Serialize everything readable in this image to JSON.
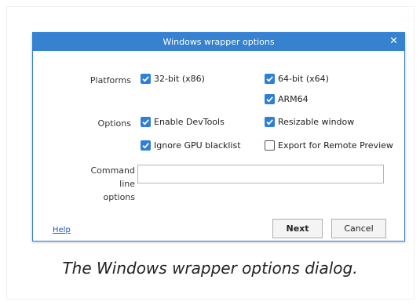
{
  "dialog": {
    "title": "Windows wrapper options",
    "close_glyph": "✕",
    "accent_color": "#2f7ed8"
  },
  "platforms": {
    "label": "Platforms",
    "options": [
      {
        "label": "32-bit (x86)",
        "checked": true
      },
      {
        "label": "64-bit (x64)",
        "checked": true
      },
      {
        "label": "ARM64",
        "checked": true
      }
    ]
  },
  "options": {
    "label": "Options",
    "items": [
      {
        "label": "Enable DevTools",
        "checked": true
      },
      {
        "label": "Resizable window",
        "checked": true
      },
      {
        "label": "Ignore GPU blacklist",
        "checked": true
      },
      {
        "label": "Export for Remote Preview",
        "checked": false
      }
    ]
  },
  "command_line": {
    "label_line1": "Command line",
    "label_line2": "options",
    "value": "",
    "placeholder": ""
  },
  "footer": {
    "help_label": "Help",
    "next_label": "Next",
    "cancel_label": "Cancel"
  },
  "caption": "The Windows wrapper options dialog."
}
